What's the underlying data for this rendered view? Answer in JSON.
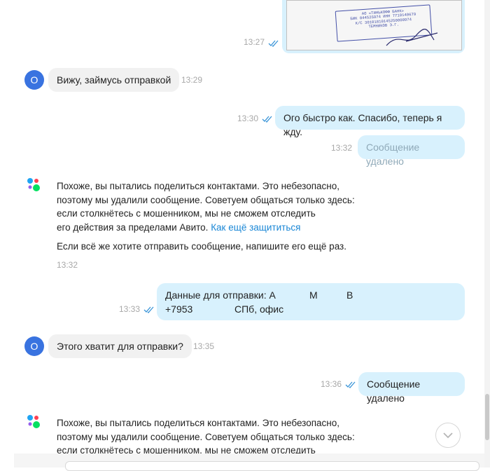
{
  "photo": {
    "time": "13:27",
    "stamp_lines": [
      "АО «ТИНЬКОФФ БАНК»",
      "БИК 044525974   ИНН 7710140679",
      "К/С 30101810145250000974",
      "ТЕМНИКОВ Э.Г."
    ]
  },
  "messages": [
    {
      "avatar": "О",
      "text": "Вижу, займусь отправкой",
      "time": "13:29"
    },
    {
      "text": "Ого быстро как. Спасибо, теперь я жду.",
      "time": "13:30"
    },
    {
      "text": "Сообщение удалено",
      "time": "13:32"
    },
    {
      "text_line1": "Данные для отправки: А",
      "text_m": "М",
      "text_v": "В",
      "text_line2a": "+7953",
      "text_line2b": "СПб, офис",
      "time": "13:33"
    },
    {
      "avatar": "О",
      "text": "Этого хватит для отправки?",
      "time": "13:35"
    },
    {
      "text": "Сообщение удалено",
      "time": "13:36"
    }
  ],
  "system_notice": {
    "lines": [
      "Похоже, вы пытались поделиться контактами. Это небезопасно,",
      "поэтому мы удалили сообщение. Советуем общаться только здесь:",
      "если столкнётесь с мошенником, мы не сможем отследить",
      "его действия за пределами Авито."
    ],
    "link": "Как ещё защититься",
    "retry": "Если всё же хотите отправить сообщение, напишите его ещё раз.",
    "time": "13:32"
  },
  "system_notice_2": {
    "lines": [
      "Похоже, вы пытались поделиться контактами. Это небезопасно,",
      "поэтому мы удалили сообщение. Советуем общаться только здесь:",
      "если столкнётесь с мошенником, мы не сможем отследить"
    ]
  },
  "icons": {
    "read_check": "double-check-icon",
    "scroll_down": "chevron-down-icon",
    "system": "avito-dots-icon"
  },
  "colors": {
    "outgoing": "#d8f1fd",
    "incoming": "#f1f1f1",
    "avatar": "#3973e0",
    "link": "#1a87d6"
  }
}
